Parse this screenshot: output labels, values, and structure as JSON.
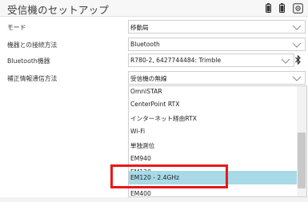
{
  "window": {
    "title": "受信機のセットアップ"
  },
  "header_icons": [
    "battery-icon",
    "battery-icon",
    "settings-icon"
  ],
  "form": {
    "mode": {
      "label": "モード",
      "value": "移動局"
    },
    "connection": {
      "label": "機器との接続方法",
      "value": "Bluetooth"
    },
    "bt_device": {
      "label": "Bluetooth機器",
      "value": "R780-2, 6427744484: Trimble"
    },
    "correction": {
      "label": "補正情報通信方法",
      "value": "受信機の無線"
    }
  },
  "dropdown": {
    "options": [
      "OmniSTAR",
      "CenterPoint RTX",
      "インターネット経由RTX",
      "Wi-Fi",
      "単独測位",
      "EM940",
      "EM120",
      "EM120 - 2.4GHz",
      "EM400"
    ],
    "selected": "EM120 - 2.4GHz"
  },
  "colors": {
    "selected_bg": "#a8d9e7",
    "highlight_border": "#e81818"
  }
}
